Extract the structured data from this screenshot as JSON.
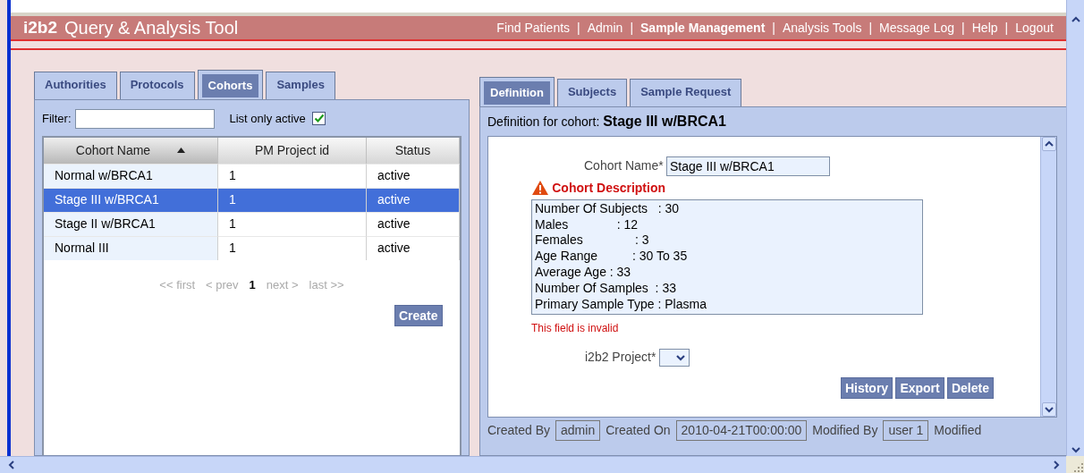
{
  "app": {
    "logo": "i2b2",
    "title": "Query & Analysis Tool"
  },
  "nav_separator": "|",
  "nav": [
    {
      "label": "Find Patients",
      "selected": false
    },
    {
      "label": "Admin",
      "selected": false
    },
    {
      "label": "Sample Management",
      "selected": true
    },
    {
      "label": "Analysis Tools",
      "selected": false
    },
    {
      "label": "Message Log",
      "selected": false
    },
    {
      "label": "Help",
      "selected": false
    },
    {
      "label": "Logout",
      "selected": false
    }
  ],
  "left_tabs": [
    {
      "label": "Authorities",
      "selected": false
    },
    {
      "label": "Protocols",
      "selected": false
    },
    {
      "label": "Cohorts",
      "selected": true
    },
    {
      "label": "Samples",
      "selected": false
    }
  ],
  "filter": {
    "label": "Filter:",
    "active_label": "List only active",
    "active_checked": true
  },
  "table": {
    "columns": [
      {
        "label": "Cohort Name",
        "sorted": true
      },
      {
        "label": "PM Project id",
        "sorted": false
      },
      {
        "label": "Status",
        "sorted": false
      }
    ],
    "rows": [
      {
        "cells": [
          "Normal w/BRCA1",
          "1",
          "active"
        ],
        "selected": false
      },
      {
        "cells": [
          "Stage III w/BRCA1",
          "1",
          "active"
        ],
        "selected": true
      },
      {
        "cells": [
          "Stage II w/BRCA1",
          "1",
          "active"
        ],
        "selected": false
      },
      {
        "cells": [
          "Normal III",
          "1",
          "active"
        ],
        "selected": false
      }
    ]
  },
  "pager": [
    {
      "label": "<< first",
      "current": false
    },
    {
      "label": "< prev",
      "current": false
    },
    {
      "label": "1",
      "current": true
    },
    {
      "label": "next >",
      "current": false
    },
    {
      "label": "last >>",
      "current": false
    }
  ],
  "create_button": "Create",
  "right_tabs": [
    {
      "label": "Definition",
      "selected": true
    },
    {
      "label": "Subjects",
      "selected": false
    },
    {
      "label": "Sample Request",
      "selected": false
    }
  ],
  "definition": {
    "heading_label": "Definition for cohort:",
    "heading_name": "Stage III w/BRCA1",
    "name_label": "Cohort Name*",
    "name_value": "Stage III w/BRCA1",
    "description_label": "Cohort Description",
    "description_lines": [
      "Number Of Subjects   : 30",
      "Males              : 12",
      "Females               : 3",
      "Age Range          : 30 To 35",
      "Average Age : 33",
      "Number Of Samples  : 33",
      "Primary Sample Type : Plasma"
    ],
    "error": "This field is invalid",
    "project_label": "i2b2 Project*",
    "buttons": [
      "History",
      "Export",
      "Delete"
    ]
  },
  "footer": [
    {
      "label": "Created By",
      "value": "admin"
    },
    {
      "label": "Created On",
      "value": "2010-04-21T00:00:00"
    },
    {
      "label": "Modified By",
      "value": "user 1"
    },
    {
      "label": "Modified"
    }
  ]
}
